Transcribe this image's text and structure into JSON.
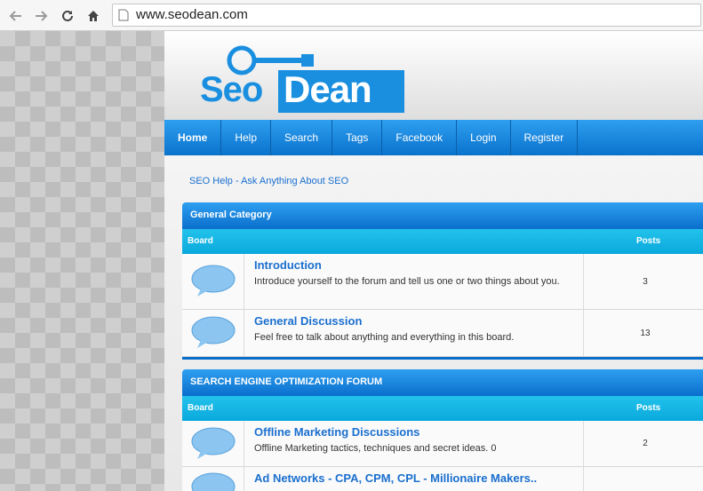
{
  "browser": {
    "url": "www.seodean.com",
    "icons": [
      "back-arrow-icon",
      "forward-arrow-icon",
      "reload-icon",
      "home-icon",
      "page-icon"
    ]
  },
  "logo": {
    "part1": "Seo",
    "part2": "Dean"
  },
  "nav": {
    "items": [
      {
        "label": "Home"
      },
      {
        "label": "Help"
      },
      {
        "label": "Search"
      },
      {
        "label": "Tags"
      },
      {
        "label": "Facebook"
      },
      {
        "label": "Login"
      },
      {
        "label": "Register"
      }
    ]
  },
  "breadcrumb": "SEO Help - Ask Anything About SEO",
  "categories": [
    {
      "title": "General Category",
      "board_header": "Board",
      "posts_header": "Posts",
      "boards": [
        {
          "title": "Introduction",
          "desc": "Introduce yourself to the forum and tell us one or two things about you.",
          "posts": "3"
        },
        {
          "title": "General Discussion",
          "desc": "Feel free to talk about anything and everything in this board.",
          "posts": "13"
        }
      ]
    },
    {
      "title": "SEARCH ENGINE OPTIMIZATION FORUM",
      "board_header": "Board",
      "posts_header": "Posts",
      "boards": [
        {
          "title": "Offline Marketing Discussions",
          "desc": "Offline Marketing tactics, techniques and secret ideas. 0",
          "posts": "2"
        },
        {
          "title": "Ad Networks - CPA, CPM, CPL - Millionaire Makers..",
          "desc": "",
          "posts": ""
        }
      ]
    }
  ],
  "colors": {
    "accent": "#1a8fe0",
    "nav_dark": "#0a72cc",
    "link": "#1a6fcf"
  }
}
